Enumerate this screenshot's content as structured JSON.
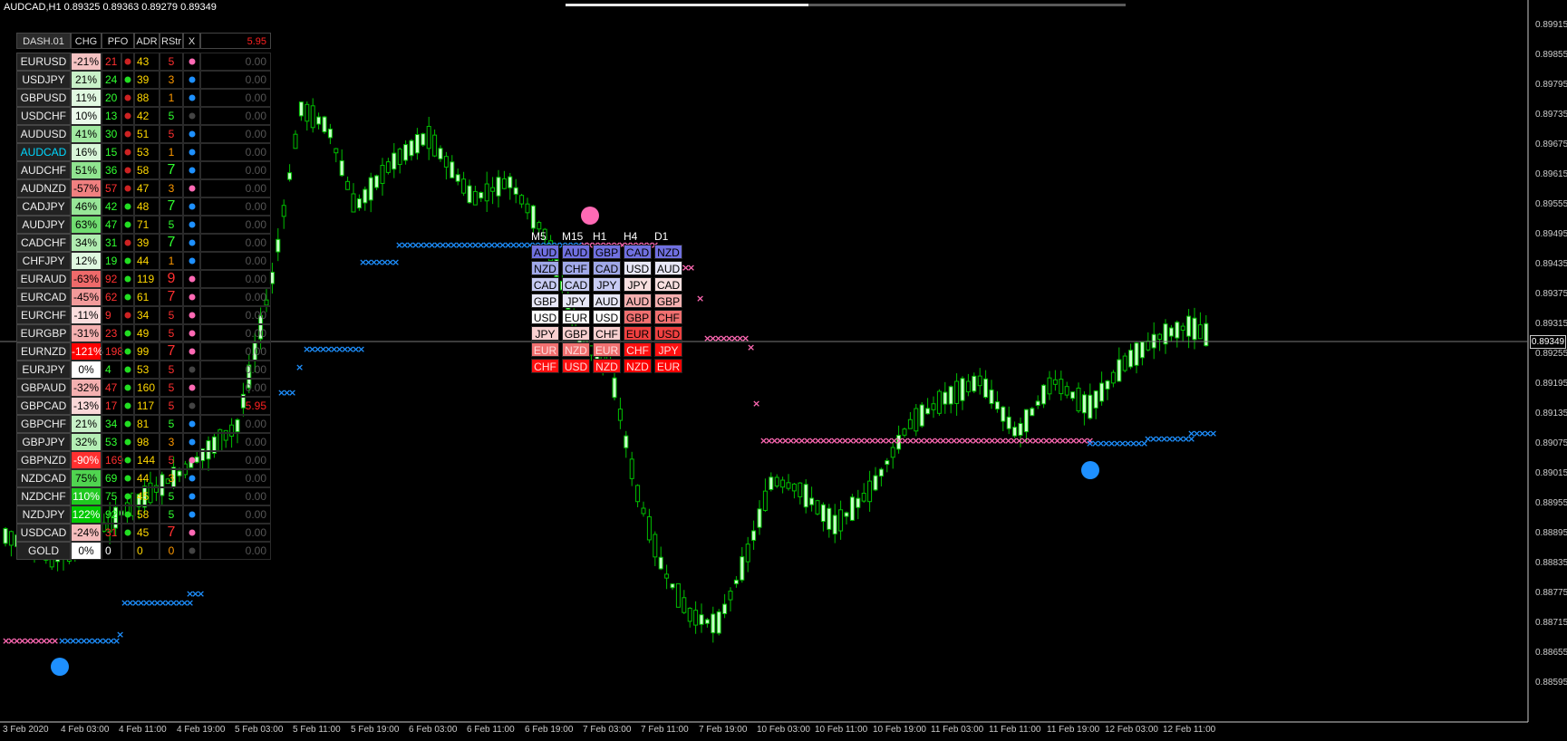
{
  "window": {
    "title": "AUDCAD,H1  0.89325 0.89363 0.89279 0.89349",
    "current_price": "0.89349",
    "colors": {
      "bull_candle": "#c8ffc8",
      "bear_candle": "#00c000",
      "bg": "#000000",
      "buy_mark": "#1e90ff",
      "sell_mark": "#ff69b4"
    }
  },
  "dashboard": {
    "header": {
      "name": "DASH.01",
      "chg": "CHG",
      "pfo": "PFO",
      "adr": "ADR",
      "rstr": "RStr",
      "x": "X",
      "value": "5.95"
    },
    "rows": [
      {
        "name": "EURUSD",
        "chg": "-21%",
        "chg_color": "#f4c2c2",
        "pfo": "21",
        "pfo_color": "#ff3030",
        "dot1": "#cc2222",
        "adr": "43",
        "rstr": "5",
        "rstr_color": "#ff3030",
        "x_dot": "#ff69b4",
        "value": "0.00"
      },
      {
        "name": "USDJPY",
        "chg": "21%",
        "chg_color": "#c8f0c8",
        "pfo": "24",
        "pfo_color": "#30ff30",
        "dot1": "#22dd22",
        "adr": "39",
        "rstr": "3",
        "rstr_color": "#ff9900",
        "x_dot": "#1e90ff",
        "value": "0.00"
      },
      {
        "name": "GBPUSD",
        "chg": "11%",
        "chg_color": "#e0f8e0",
        "pfo": "20",
        "pfo_color": "#30ff30",
        "dot1": "#cc2222",
        "adr": "88",
        "rstr": "1",
        "rstr_color": "#ff9900",
        "x_dot": "#1e90ff",
        "value": "0.00"
      },
      {
        "name": "USDCHF",
        "chg": "10%",
        "chg_color": "#eafaea",
        "pfo": "13",
        "pfo_color": "#30ff30",
        "dot1": "#cc2222",
        "adr": "42",
        "rstr": "5",
        "rstr_color": "#30ff30",
        "x_dot": "#444444",
        "value": "0.00"
      },
      {
        "name": "AUDUSD",
        "chg": "41%",
        "chg_color": "#a0e8a0",
        "pfo": "30",
        "pfo_color": "#30ff30",
        "dot1": "#cc2222",
        "adr": "51",
        "rstr": "5",
        "rstr_color": "#ff3030",
        "x_dot": "#1e90ff",
        "value": "0.00"
      },
      {
        "name": "AUDCAD",
        "name_color": "#00d8ff",
        "chg": "16%",
        "chg_color": "#d8f6d8",
        "pfo": "15",
        "pfo_color": "#30ff30",
        "dot1": "#cc2222",
        "adr": "53",
        "rstr": "1",
        "rstr_color": "#ff9900",
        "x_dot": "#1e90ff",
        "value": "0.00"
      },
      {
        "name": "AUDCHF",
        "chg": "51%",
        "chg_color": "#90e490",
        "pfo": "36",
        "pfo_color": "#30ff30",
        "dot1": "#cc2222",
        "adr": "58",
        "rstr": "7",
        "rstr_color": "#30ff30",
        "x_dot": "#1e90ff",
        "value": "0.00"
      },
      {
        "name": "AUDNZD",
        "chg": "-57%",
        "chg_color": "#f08080",
        "pfo": "57",
        "pfo_color": "#ff3030",
        "dot1": "#cc2222",
        "adr": "47",
        "rstr": "3",
        "rstr_color": "#ff9900",
        "x_dot": "#ff69b4",
        "value": "0.00"
      },
      {
        "name": "CADJPY",
        "chg": "46%",
        "chg_color": "#98e698",
        "pfo": "42",
        "pfo_color": "#30ff30",
        "dot1": "#22dd22",
        "adr": "48",
        "rstr": "7",
        "rstr_color": "#30ff30",
        "x_dot": "#1e90ff",
        "value": "0.00"
      },
      {
        "name": "AUDJPY",
        "chg": "63%",
        "chg_color": "#70dc70",
        "pfo": "47",
        "pfo_color": "#30ff30",
        "dot1": "#22dd22",
        "adr": "71",
        "rstr": "5",
        "rstr_color": "#30ff30",
        "x_dot": "#1e90ff",
        "value": "0.00"
      },
      {
        "name": "CADCHF",
        "chg": "34%",
        "chg_color": "#b0ecb0",
        "pfo": "31",
        "pfo_color": "#30ff30",
        "dot1": "#cc2222",
        "adr": "39",
        "rstr": "7",
        "rstr_color": "#30ff30",
        "x_dot": "#1e90ff",
        "value": "0.00"
      },
      {
        "name": "CHFJPY",
        "chg": "12%",
        "chg_color": "#e0f8e0",
        "pfo": "19",
        "pfo_color": "#30ff30",
        "dot1": "#22dd22",
        "adr": "44",
        "rstr": "1",
        "rstr_color": "#ff9900",
        "x_dot": "#1e90ff",
        "value": "0.00"
      },
      {
        "name": "EURAUD",
        "chg": "-63%",
        "chg_color": "#ee6a6a",
        "pfo": "92",
        "pfo_color": "#ff3030",
        "dot1": "#22dd22",
        "adr": "119",
        "rstr": "9",
        "rstr_color": "#ff3030",
        "x_dot": "#ff69b4",
        "value": "0.00"
      },
      {
        "name": "EURCAD",
        "chg": "-45%",
        "chg_color": "#f29a9a",
        "pfo": "62",
        "pfo_color": "#ff3030",
        "dot1": "#22dd22",
        "adr": "61",
        "rstr": "7",
        "rstr_color": "#ff3030",
        "x_dot": "#ff69b4",
        "value": "0.00"
      },
      {
        "name": "EURCHF",
        "chg": "-11%",
        "chg_color": "#fadede",
        "pfo": "9",
        "pfo_color": "#ff3030",
        "dot1": "#cc2222",
        "adr": "34",
        "rstr": "5",
        "rstr_color": "#ff3030",
        "x_dot": "#ff69b4",
        "value": "0.00"
      },
      {
        "name": "EURGBP",
        "chg": "-31%",
        "chg_color": "#f4b0b0",
        "pfo": "23",
        "pfo_color": "#ff3030",
        "dot1": "#22dd22",
        "adr": "49",
        "rstr": "5",
        "rstr_color": "#ff3030",
        "x_dot": "#ff69b4",
        "value": "0.00"
      },
      {
        "name": "EURNZD",
        "chg": "-121%",
        "chg_color": "#ff0000",
        "pfo": "198",
        "pfo_color": "#ff3030",
        "dot1": "#22dd22",
        "adr": "99",
        "rstr": "7",
        "rstr_color": "#ff3030",
        "x_dot": "#ff69b4",
        "value": "0.00"
      },
      {
        "name": "EURJPY",
        "chg": "0%",
        "chg_color": "#ffffff",
        "pfo": "4",
        "pfo_color": "#30ff30",
        "dot1": "#22dd22",
        "adr": "53",
        "rstr": "5",
        "rstr_color": "#ff3030",
        "x_dot": "#444444",
        "value": "0.00"
      },
      {
        "name": "GBPAUD",
        "chg": "-32%",
        "chg_color": "#f4b0b0",
        "pfo": "47",
        "pfo_color": "#ff3030",
        "dot1": "#22dd22",
        "adr": "160",
        "rstr": "5",
        "rstr_color": "#ff3030",
        "x_dot": "#ff69b4",
        "value": "0.00"
      },
      {
        "name": "GBPCAD",
        "chg": "-13%",
        "chg_color": "#fad8d8",
        "pfo": "17",
        "pfo_color": "#ff3030",
        "dot1": "#22dd22",
        "adr": "117",
        "rstr": "5",
        "rstr_color": "#ff3030",
        "x_dot": "#444444",
        "value": "5.95",
        "value_color": "#ff2020"
      },
      {
        "name": "GBPCHF",
        "chg": "21%",
        "chg_color": "#c8f0c8",
        "pfo": "34",
        "pfo_color": "#30ff30",
        "dot1": "#22dd22",
        "adr": "81",
        "rstr": "5",
        "rstr_color": "#30ff30",
        "x_dot": "#1e90ff",
        "value": "0.00"
      },
      {
        "name": "GBPJPY",
        "chg": "32%",
        "chg_color": "#b4eeb4",
        "pfo": "53",
        "pfo_color": "#30ff30",
        "dot1": "#22dd22",
        "adr": "98",
        "rstr": "3",
        "rstr_color": "#ff9900",
        "x_dot": "#1e90ff",
        "value": "0.00"
      },
      {
        "name": "GBPNZD",
        "chg": "-90%",
        "chg_color": "#ff3030",
        "pfo": "169",
        "pfo_color": "#ff3030",
        "dot1": "#22dd22",
        "adr": "144",
        "rstr": "5",
        "rstr_color": "#ff3030",
        "x_dot": "#ff69b4",
        "value": "0.00"
      },
      {
        "name": "NZDCAD",
        "chg": "75%",
        "chg_color": "#50d450",
        "pfo": "69",
        "pfo_color": "#30ff30",
        "dot1": "#22dd22",
        "adr": "44",
        "rstr": "3",
        "rstr_color": "#ff9900",
        "x_dot": "#1e90ff",
        "value": "0.00"
      },
      {
        "name": "NZDCHF",
        "chg": "110%",
        "chg_color": "#20c820",
        "pfo": "75",
        "pfo_color": "#30ff30",
        "dot1": "#22dd22",
        "adr": "45",
        "rstr": "5",
        "rstr_color": "#30ff30",
        "x_dot": "#1e90ff",
        "value": "0.00"
      },
      {
        "name": "NZDJPY",
        "chg": "122%",
        "chg_color": "#00c800",
        "pfo": "92",
        "pfo_color": "#30ff30",
        "dot1": "#22dd22",
        "adr": "58",
        "rstr": "5",
        "rstr_color": "#30ff30",
        "x_dot": "#1e90ff",
        "value": "0.00"
      },
      {
        "name": "USDCAD",
        "chg": "-24%",
        "chg_color": "#f4bcbc",
        "pfo": "31",
        "pfo_color": "#ff3030",
        "dot1": "#22dd22",
        "adr": "45",
        "rstr": "7",
        "rstr_color": "#ff3030",
        "x_dot": "#ff69b4",
        "value": "0.00"
      },
      {
        "name": "GOLD",
        "chg": "0%",
        "chg_color": "#ffffff",
        "pfo": "0",
        "pfo_color": "#ffffff",
        "dot1": "",
        "adr": "0",
        "rstr": "0",
        "rstr_color": "#ff9900",
        "x_dot": "#444444",
        "value": "0.00"
      }
    ]
  },
  "matrix": {
    "timeframes": [
      "M5",
      "M15",
      "H1",
      "H4",
      "D1"
    ],
    "columns": [
      [
        "AUD",
        "NZD",
        "CAD",
        "GBP",
        "USD",
        "JPY",
        "EUR",
        "CHF"
      ],
      [
        "AUD",
        "CHF",
        "CAD",
        "JPY",
        "EUR",
        "GBP",
        "NZD",
        "USD"
      ],
      [
        "GBP",
        "CAD",
        "JPY",
        "AUD",
        "USD",
        "CHF",
        "EUR",
        "NZD"
      ],
      [
        "CAD",
        "USD",
        "JPY",
        "AUD",
        "GBP",
        "EUR",
        "CHF",
        "NZD"
      ],
      [
        "NZD",
        "AUD",
        "CAD",
        "GBP",
        "CHF",
        "USD",
        "JPY",
        "EUR"
      ]
    ],
    "row_colors": [
      "#7070e0",
      "#a0a8e8",
      "#c8ccf4",
      "#e8e8f8",
      "#ffffff",
      "#f8d0d0",
      "#f07070",
      "#ff1010"
    ],
    "d1_colors": [
      "#7070e0",
      "#e8e8f8",
      "#f8e0e0",
      "#f4b0b0",
      "#f07070",
      "#f04040",
      "#ff1010",
      "#ff0000"
    ]
  },
  "price_axis": [
    "0.89915",
    "0.89855",
    "0.89795",
    "0.89735",
    "0.89675",
    "0.89615",
    "0.89555",
    "0.89495",
    "0.89435",
    "0.89375",
    "0.89315",
    "0.89255",
    "0.89195",
    "0.89135",
    "0.89075",
    "0.89015",
    "0.88955",
    "0.88895",
    "0.88835",
    "0.88775",
    "0.88715",
    "0.88655",
    "0.88595"
  ],
  "time_axis": [
    "3 Feb 2020",
    "4 Feb 03:00",
    "4 Feb 11:00",
    "4 Feb 19:00",
    "5 Feb 03:00",
    "5 Feb 11:00",
    "5 Feb 19:00",
    "6 Feb 03:00",
    "6 Feb 11:00",
    "6 Feb 19:00",
    "7 Feb 03:00",
    "7 Feb 11:00",
    "7 Feb 19:00",
    "10 Feb 03:00",
    "10 Feb 11:00",
    "10 Feb 19:00",
    "11 Feb 03:00",
    "11 Feb 11:00",
    "11 Feb 19:00",
    "12 Feb 03:00",
    "12 Feb 11:00"
  ]
}
